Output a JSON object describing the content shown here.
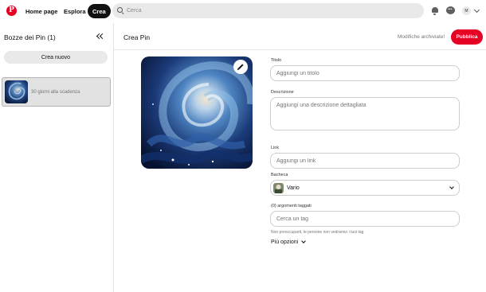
{
  "nav": {
    "logo_icon": "pinterest-logo",
    "home": "Home page",
    "explore": "Esplora",
    "create": "Crea",
    "search_placeholder": "Cerca",
    "icons": [
      "search-icon",
      "bell-icon",
      "chat-icon",
      "chevron-down-icon"
    ],
    "avatar_initial": "M"
  },
  "sidebar": {
    "title": "Bozze dei Pin",
    "count": "(1)",
    "new_button": "Crea nuovo",
    "drafts": [
      {
        "label": "30 giorni alla scadenza"
      }
    ]
  },
  "main": {
    "title": "Crea Pin",
    "save_status": "Modifiche archiviate!",
    "publish": "Pubblica"
  },
  "form": {
    "title_label": "Titolo",
    "title_placeholder": "Aggiungi un titolo",
    "description_label": "Descrizione",
    "description_placeholder": "Aggiungi una descrizione dettagliata",
    "link_label": "Link",
    "link_placeholder": "Aggiungi un link",
    "board_label": "Bacheca",
    "board_value": "Vario",
    "tags_label": "(0) argomenti taggati",
    "tags_placeholder": "Cerca un tag",
    "tags_hint": "Non preoccuparti, le persone non vedranno i tuoi tag",
    "more_options": "Più opzioni"
  },
  "colors": {
    "accent": "#e60023",
    "create_button": "#111111",
    "search_bg": "#e9e9e9"
  }
}
